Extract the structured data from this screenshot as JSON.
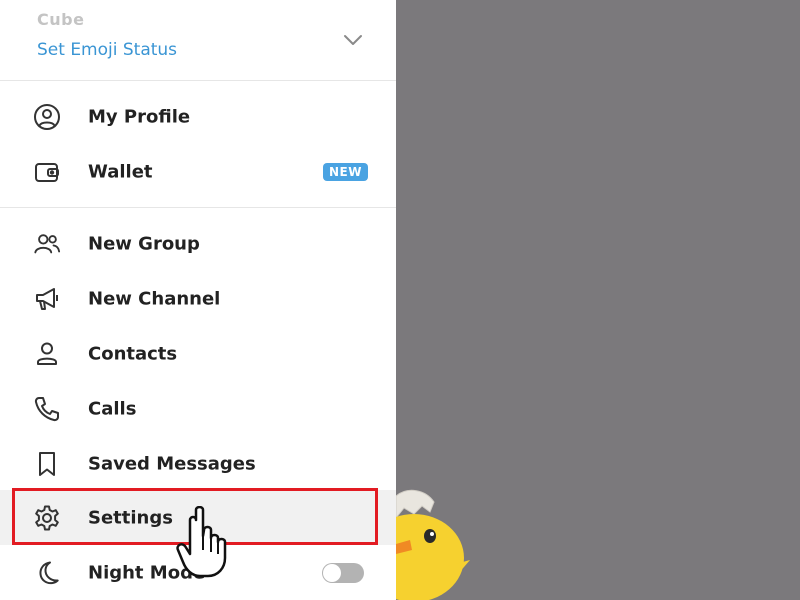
{
  "header": {
    "user_name": "Cube",
    "emoji_status": "Set Emoji Status"
  },
  "menu": {
    "my_profile": "My Profile",
    "wallet": "Wallet",
    "wallet_badge": "NEW",
    "new_group": "New Group",
    "new_channel": "New Channel",
    "contacts": "Contacts",
    "calls": "Calls",
    "saved_messages": "Saved Messages",
    "settings": "Settings",
    "night_mode": "Night Mode"
  },
  "night_mode_enabled": false,
  "colors": {
    "accent": "#3a95d4",
    "badge": "#4aa3e2",
    "highlight_border": "#e21b22",
    "overlay": "#7b797c"
  }
}
